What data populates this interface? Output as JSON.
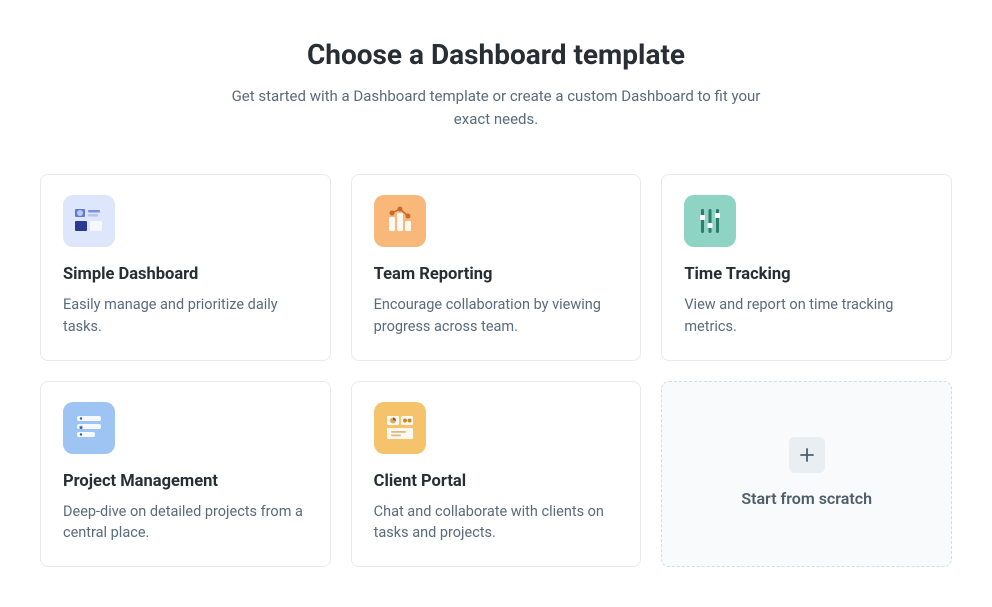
{
  "header": {
    "title": "Choose a Dashboard template",
    "subtitle": "Get started with a Dashboard template or create a custom Dashboard to fit your exact needs."
  },
  "templates": {
    "simple": {
      "title": "Simple Dashboard",
      "desc": "Easily manage and prioritize daily tasks.",
      "icon": "simple-dashboard-icon"
    },
    "team": {
      "title": "Team Reporting",
      "desc": "Encourage collaboration by viewing progress across team.",
      "icon": "team-reporting-icon"
    },
    "time": {
      "title": "Time Tracking",
      "desc": "View and report on time tracking metrics.",
      "icon": "time-tracking-icon"
    },
    "project": {
      "title": "Project Management",
      "desc": "Deep-dive on detailed projects from a central place.",
      "icon": "project-management-icon"
    },
    "client": {
      "title": "Client Portal",
      "desc": "Chat and collaborate with clients on tasks and projects.",
      "icon": "client-portal-icon"
    }
  },
  "scratch": {
    "label": "Start from scratch",
    "icon": "plus-icon"
  }
}
